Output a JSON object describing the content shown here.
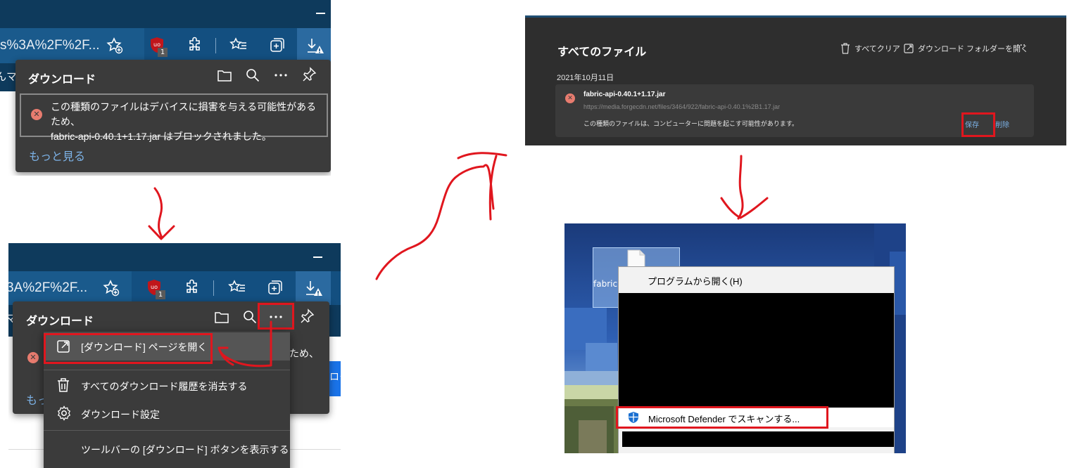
{
  "panel_a": {
    "address_fragment": "s%3A%2F%2F...",
    "partial_left_text": "んマ",
    "extension_badge": "1",
    "download_title": "ダウンロード",
    "alert_line1": "この種類のファイルはデバイスに損害を与える可能性があるため、",
    "alert_line2": "fabric-api-0.40.1+1.17.jar はブロックされました。",
    "more_link": "もっと見る"
  },
  "panel_b": {
    "address_fragment": "3A%2F%2F...",
    "partial_left_text": "マ",
    "extension_badge": "1",
    "download_title": "ダウンロード",
    "partial_alert_text": "ため、",
    "partial_more_text": "もっ",
    "partial_right_text": "ロク",
    "menu_items": [
      {
        "label": "[ダウンロード] ページを開く",
        "icon": "open-external-icon"
      },
      {
        "label": "すべてのダウンロード履歴を消去する",
        "icon": "trash-icon"
      },
      {
        "label": "ダウンロード設定",
        "icon": "gear-icon"
      },
      {
        "label": "ツールバーの [ダウンロード] ボタンを表示する",
        "icon": ""
      }
    ]
  },
  "panel_c": {
    "title": "すべてのファイル",
    "clear_all": "すべてクリア",
    "open_folder": "ダウンロード フォルダーを開く",
    "date": "2021年10月11日",
    "file_name": "fabric-api-0.40.1+1.17.jar",
    "file_url": "https://media.forgecdn.net/files/3464/922/fabric-api-0.40.1%2B1.17.jar",
    "warning": "この種類のファイルは、コンピューターに問題を起こす可能性があります。",
    "save_label": "保存",
    "delete_label": "削除"
  },
  "panel_d": {
    "file_label": "fabric",
    "open_with": "プログラムから開く(H)",
    "defender_scan": "Microsoft Defender でスキャンする..."
  },
  "colors": {
    "annotation_red": "#e0161e",
    "edge_titlebar": "#0e3a5c",
    "edge_toolbar": "#134f80",
    "popup_bg": "#3b3b3b",
    "link_blue": "#7db3e8"
  }
}
